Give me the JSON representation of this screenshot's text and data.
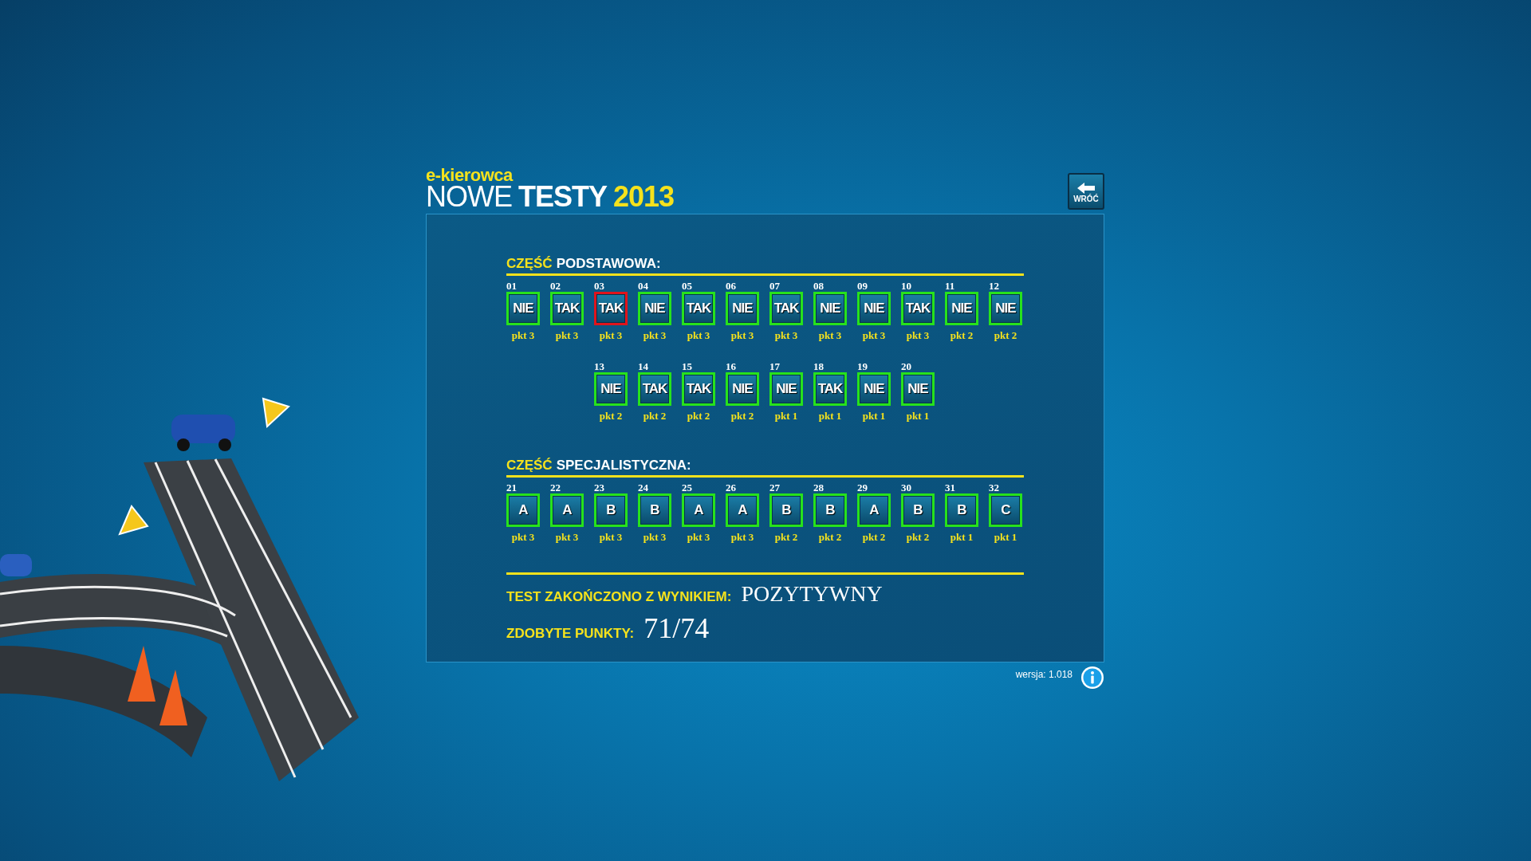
{
  "header": {
    "brand": "e-kierowca",
    "title_light": "NOWE",
    "title_bold": "TESTY",
    "title_year": "2013",
    "back_button": "WRÓĆ"
  },
  "sections": [
    {
      "heading_accent": "CZĘŚĆ",
      "heading_rest": "PODSTAWOWA:",
      "rows": [
        [
          {
            "number": "01",
            "answer": "NIE",
            "points": "pkt 3",
            "correct": true
          },
          {
            "number": "02",
            "answer": "TAK",
            "points": "pkt 3",
            "correct": true
          },
          {
            "number": "03",
            "answer": "TAK",
            "points": "pkt 3",
            "correct": false
          },
          {
            "number": "04",
            "answer": "NIE",
            "points": "pkt 3",
            "correct": true
          },
          {
            "number": "05",
            "answer": "TAK",
            "points": "pkt 3",
            "correct": true
          },
          {
            "number": "06",
            "answer": "NIE",
            "points": "pkt 3",
            "correct": true
          },
          {
            "number": "07",
            "answer": "TAK",
            "points": "pkt 3",
            "correct": true
          },
          {
            "number": "08",
            "answer": "NIE",
            "points": "pkt 3",
            "correct": true
          },
          {
            "number": "09",
            "answer": "NIE",
            "points": "pkt 3",
            "correct": true
          },
          {
            "number": "10",
            "answer": "TAK",
            "points": "pkt 3",
            "correct": true
          },
          {
            "number": "11",
            "answer": "NIE",
            "points": "pkt 2",
            "correct": true
          },
          {
            "number": "12",
            "answer": "NIE",
            "points": "pkt 2",
            "correct": true
          }
        ],
        [
          null,
          null,
          {
            "number": "13",
            "answer": "NIE",
            "points": "pkt 2",
            "correct": true
          },
          {
            "number": "14",
            "answer": "TAK",
            "points": "pkt 2",
            "correct": true
          },
          {
            "number": "15",
            "answer": "TAK",
            "points": "pkt 2",
            "correct": true
          },
          {
            "number": "16",
            "answer": "NIE",
            "points": "pkt 2",
            "correct": true
          },
          {
            "number": "17",
            "answer": "NIE",
            "points": "pkt 1",
            "correct": true
          },
          {
            "number": "18",
            "answer": "TAK",
            "points": "pkt 1",
            "correct": true
          },
          {
            "number": "19",
            "answer": "NIE",
            "points": "pkt 1",
            "correct": true
          },
          {
            "number": "20",
            "answer": "NIE",
            "points": "pkt 1",
            "correct": true
          }
        ]
      ]
    },
    {
      "heading_accent": "CZĘŚĆ",
      "heading_rest": "SPECJALISTYCZNA:",
      "rows": [
        [
          {
            "number": "21",
            "answer": "A",
            "points": "pkt 3",
            "correct": true
          },
          {
            "number": "22",
            "answer": "A",
            "points": "pkt 3",
            "correct": true
          },
          {
            "number": "23",
            "answer": "B",
            "points": "pkt 3",
            "correct": true
          },
          {
            "number": "24",
            "answer": "B",
            "points": "pkt 3",
            "correct": true
          },
          {
            "number": "25",
            "answer": "A",
            "points": "pkt 3",
            "correct": true
          },
          {
            "number": "26",
            "answer": "A",
            "points": "pkt 3",
            "correct": true
          },
          {
            "number": "27",
            "answer": "B",
            "points": "pkt 2",
            "correct": true
          },
          {
            "number": "28",
            "answer": "B",
            "points": "pkt 2",
            "correct": true
          },
          {
            "number": "29",
            "answer": "A",
            "points": "pkt 2",
            "correct": true
          },
          {
            "number": "30",
            "answer": "B",
            "points": "pkt 2",
            "correct": true
          },
          {
            "number": "31",
            "answer": "B",
            "points": "pkt 1",
            "correct": true
          },
          {
            "number": "32",
            "answer": "C",
            "points": "pkt 1",
            "correct": true
          }
        ]
      ]
    }
  ],
  "result": {
    "label": "TEST ZAKOŃCZONO Z WYNIKIEM:",
    "value": "POZYTYWNY"
  },
  "score": {
    "label": "ZDOBYTE PUNKTY:",
    "value": "71/74"
  },
  "version": "wersja: 1.018"
}
